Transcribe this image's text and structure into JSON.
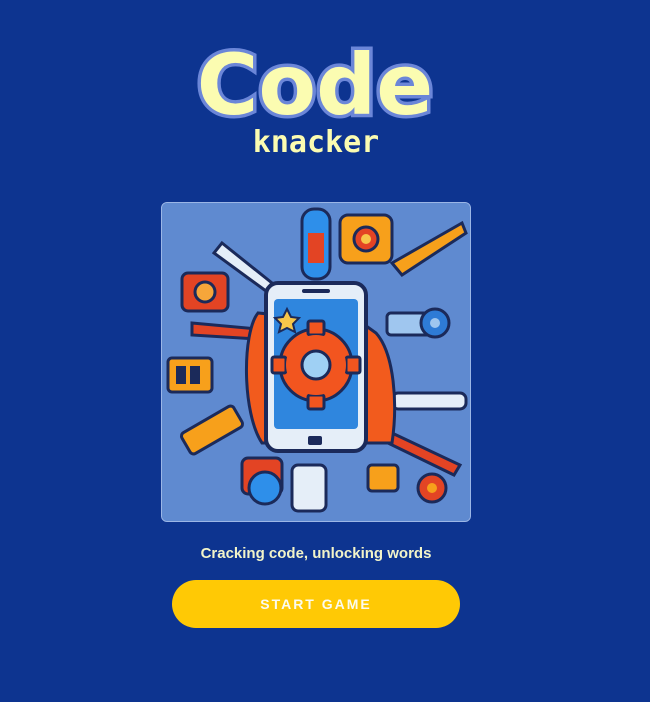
{
  "logo": {
    "title": "Code",
    "subtitle": "knacker"
  },
  "tagline": "Cracking code, unlocking words",
  "start_button_label": "START GAME",
  "colors": {
    "background": "#0d3490",
    "logo_text": "#fbfcb1",
    "button": "#ffc905",
    "tagline": "#f2f4c9"
  }
}
